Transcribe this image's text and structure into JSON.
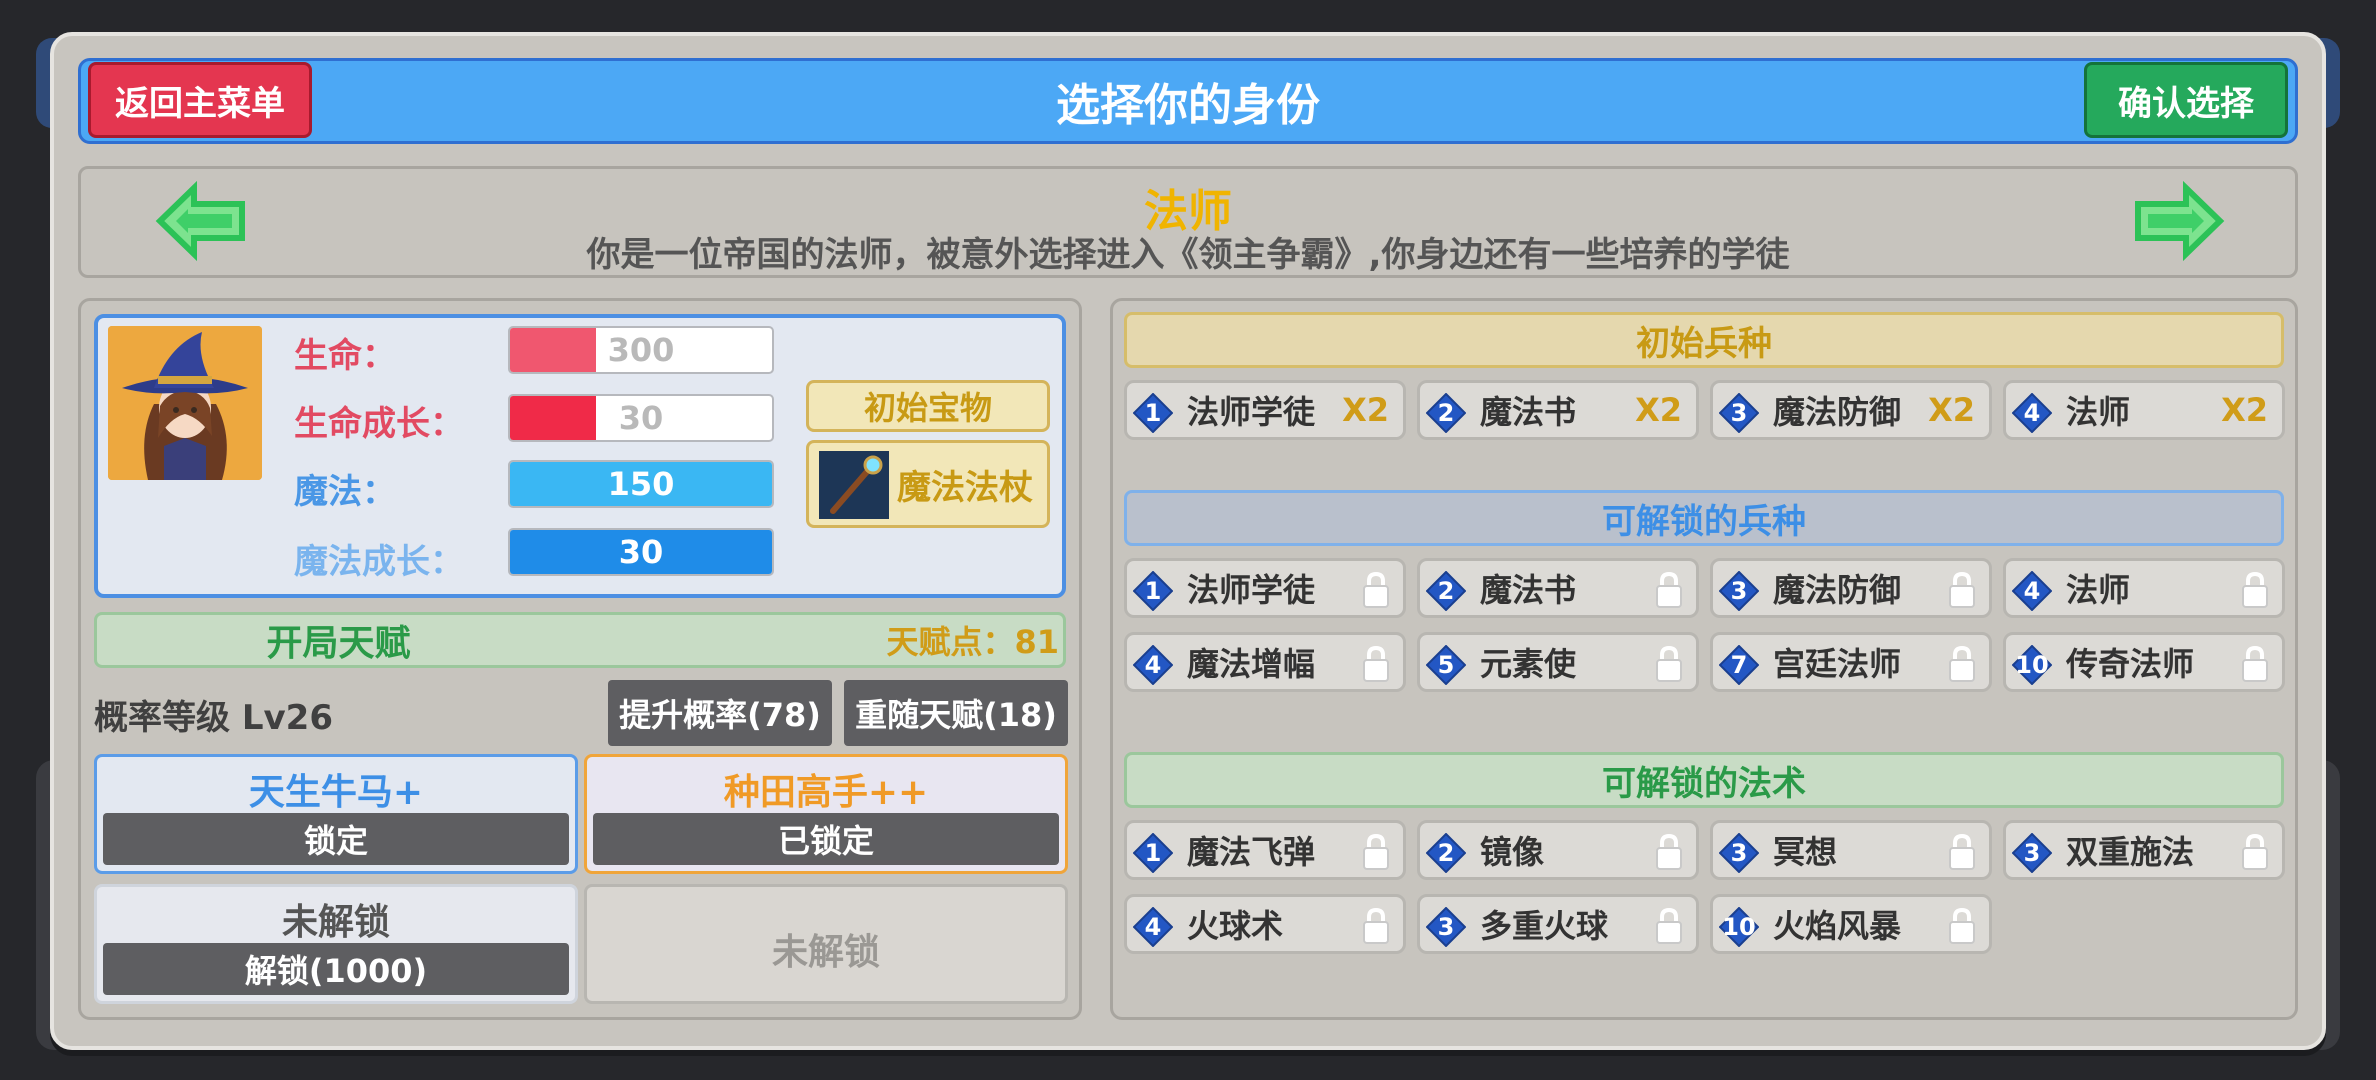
{
  "header": {
    "title": "选择你的身份",
    "back_label": "返回主菜单",
    "confirm_label": "确认选择"
  },
  "identity": {
    "name": "法师",
    "description": "你是一位帝国的法师，被意外选择进入《领主争霸》,你身边还有一些培养的学徒"
  },
  "stats": [
    {
      "label": "生命：",
      "value": "300",
      "fill": 0.33,
      "color": "#f0576f",
      "label_color": "#e24a62",
      "text_color": "#b9b9b9"
    },
    {
      "label": "生命成长：",
      "value": "30",
      "fill": 0.33,
      "color": "#f02a48",
      "label_color": "#e24a62",
      "text_color": "#b9b9b9"
    },
    {
      "label": "魔法：",
      "value": "150",
      "fill": 1.0,
      "color": "#3ab7f3",
      "label_color": "#4a97e6",
      "text_color": "#ffffff"
    },
    {
      "label": "魔法成长：",
      "value": "30",
      "fill": 1.0,
      "color": "#1f8ce8",
      "label_color": "#7ab4ee",
      "text_color": "#ffffff"
    }
  ],
  "treasure": {
    "label": "初始宝物",
    "name": "魔法法杖"
  },
  "talent": {
    "title": "开局天赋",
    "points": "天赋点：81",
    "prob_level": "概率等级 Lv26",
    "raise_label": "提升概率(78)",
    "reroll_label": "重随天赋(18)",
    "cards": [
      {
        "name": "天生牛马+",
        "button": "锁定",
        "name_color": "#3d8fe6",
        "border": "#5b9ce8",
        "bg": "#e3e8f1"
      },
      {
        "name": "种田高手++",
        "button": "已锁定",
        "name_color": "#f09a26",
        "border": "#f0a53a",
        "bg": "#e8e6f1"
      },
      {
        "name": "未解锁",
        "button": "解锁(1000)",
        "name_color": "#555555",
        "border": "#cfd4dc",
        "bg": "#e6e8ee"
      },
      {
        "name": "未解锁",
        "button": "",
        "name_color": "#9a9894",
        "border": "#b8b6b1",
        "bg": "#d9d6d1"
      }
    ]
  },
  "initial_units": {
    "title": "初始兵种",
    "items": [
      {
        "level": "1",
        "name": "法师学徒",
        "count": "X2"
      },
      {
        "level": "2",
        "name": "魔法书",
        "count": "X2"
      },
      {
        "level": "3",
        "name": "魔法防御",
        "count": "X2"
      },
      {
        "level": "4",
        "name": "法师",
        "count": "X2"
      }
    ]
  },
  "unlockable_units": {
    "title": "可解锁的兵种",
    "items": [
      {
        "level": "1",
        "name": "法师学徒"
      },
      {
        "level": "2",
        "name": "魔法书"
      },
      {
        "level": "3",
        "name": "魔法防御"
      },
      {
        "level": "4",
        "name": "法师"
      },
      {
        "level": "4",
        "name": "魔法增幅"
      },
      {
        "level": "5",
        "name": "元素使"
      },
      {
        "level": "7",
        "name": "宫廷法师"
      },
      {
        "level": "10",
        "name": "传奇法师"
      }
    ]
  },
  "unlockable_spells": {
    "title": "可解锁的法术",
    "items": [
      {
        "level": "1",
        "name": "魔法飞弹"
      },
      {
        "level": "2",
        "name": "镜像"
      },
      {
        "level": "3",
        "name": "冥想"
      },
      {
        "level": "3",
        "name": "双重施法"
      },
      {
        "level": "4",
        "name": "火球术"
      },
      {
        "level": "3",
        "name": "多重火球"
      },
      {
        "level": "10",
        "name": "火焰风暴"
      }
    ]
  },
  "icons": {
    "prev": "arrow-left-icon",
    "next": "arrow-right-icon",
    "lock": "lock-icon",
    "level": "diamond-level-badge-icon"
  }
}
